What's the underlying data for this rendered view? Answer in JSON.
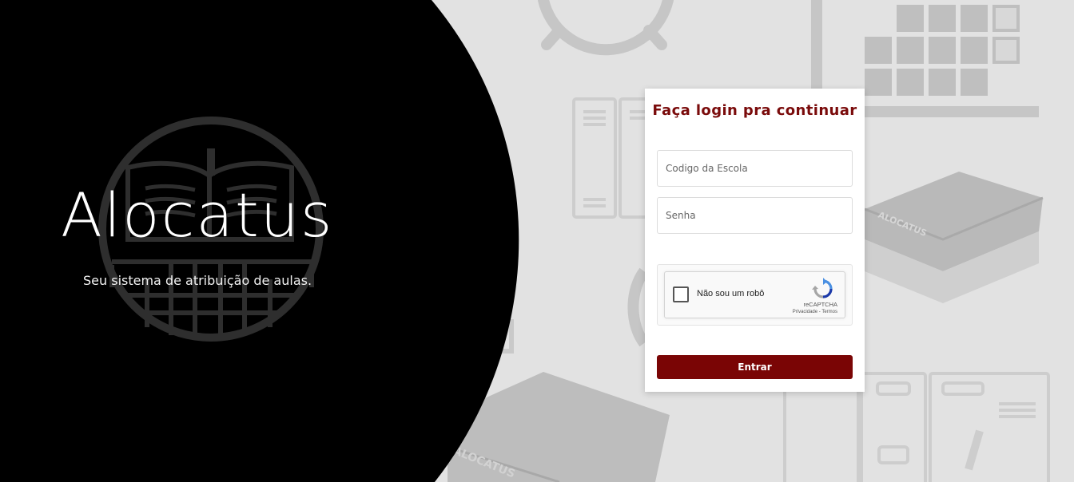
{
  "hero": {
    "brand": "Alocatus",
    "tagline": "Seu sistema de atribuição de aulas."
  },
  "login": {
    "title": "Faça login pra continuar",
    "school_code_placeholder": "Codigo da Escola",
    "password_placeholder": "Senha",
    "submit_label": "Entrar"
  },
  "recaptcha": {
    "checkbox_label": "Não sou um robô",
    "brand": "reCAPTCHA",
    "privacy_link": "Privacidade",
    "separator": " - ",
    "terms_link": "Termos"
  },
  "decor": {
    "book_spine_text": "ALOCATUS"
  },
  "colors": {
    "accent": "#7a0505",
    "title": "#7a0b0b",
    "hero_bg": "#000000",
    "page_bg": "#e2e2e2"
  },
  "icons": {
    "logo": "open-book-grid-emblem",
    "captcha": "recaptcha-arrows-icon"
  }
}
